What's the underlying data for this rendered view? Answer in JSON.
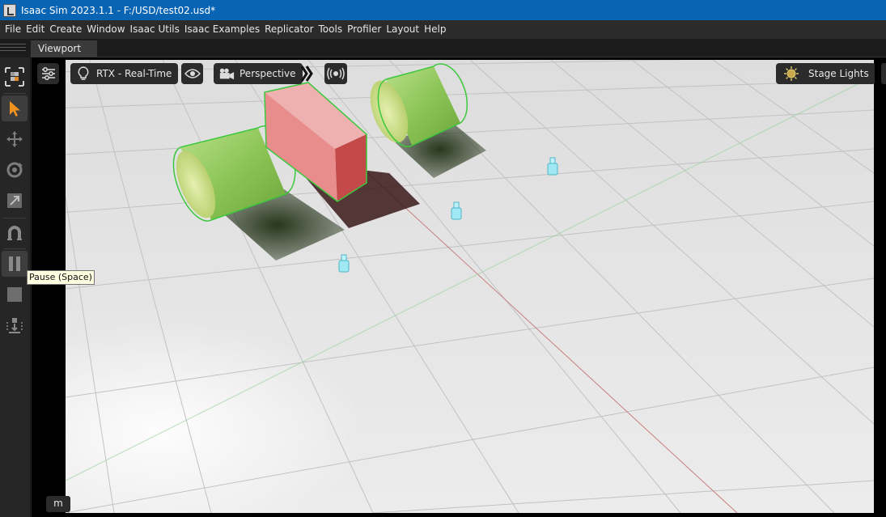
{
  "window": {
    "title": "Isaac Sim 2023.1.1 - F:/USD/test02.usd*",
    "app_icon": "isaac-sim-app-icon"
  },
  "menu": [
    {
      "label": "File"
    },
    {
      "label": "Edit"
    },
    {
      "label": "Create"
    },
    {
      "label": "Window"
    },
    {
      "label": "Isaac Utils"
    },
    {
      "label": "Isaac Examples"
    },
    {
      "label": "Replicator"
    },
    {
      "label": "Tools"
    },
    {
      "label": "Profiler"
    },
    {
      "label": "Layout"
    },
    {
      "label": "Help"
    }
  ],
  "tabs": [
    {
      "label": "Viewport",
      "active": true
    }
  ],
  "left_toolbar": {
    "tools": [
      {
        "name": "select-mode-icon"
      },
      {
        "name": "select-arrow-icon",
        "active": true
      },
      {
        "name": "move-icon"
      },
      {
        "name": "rotate-icon"
      },
      {
        "name": "scale-icon"
      },
      {
        "name": "snap-magnet-icon"
      },
      {
        "name": "pause-icon"
      },
      {
        "name": "stop-icon"
      },
      {
        "name": "physics-drop-icon"
      }
    ]
  },
  "viewport": {
    "settings_icon": "sliders-icon",
    "renderer_label": "RTX - Real-Time",
    "renderer_icon": "lightbulb-icon",
    "visibility_icon": "eye-icon",
    "camera_label": "Perspective",
    "camera_icon": "camera-icon",
    "expand_icon": "double-chevron-right-icon",
    "broadcast_icon": "broadcast-icon",
    "lights_label": "Stage Lights",
    "lights_icon": "sun-icon",
    "tooltip": "Pause (Space)",
    "hud_badge": "m"
  },
  "colors": {
    "titlebar": "#0a64b4",
    "selection_outline": "#3cc83c",
    "cylinder": "#8fc95a",
    "cube": "#e89a9a",
    "ground": "#e6e6e6",
    "light_marker": "#7fe0f0"
  },
  "scene": {
    "objects": [
      {
        "name": "cylinder-left",
        "selected": true
      },
      {
        "name": "cube",
        "selected": true
      },
      {
        "name": "cylinder-right",
        "selected": true
      },
      {
        "name": "light-marker-1"
      },
      {
        "name": "light-marker-2"
      },
      {
        "name": "light-marker-3"
      }
    ]
  }
}
